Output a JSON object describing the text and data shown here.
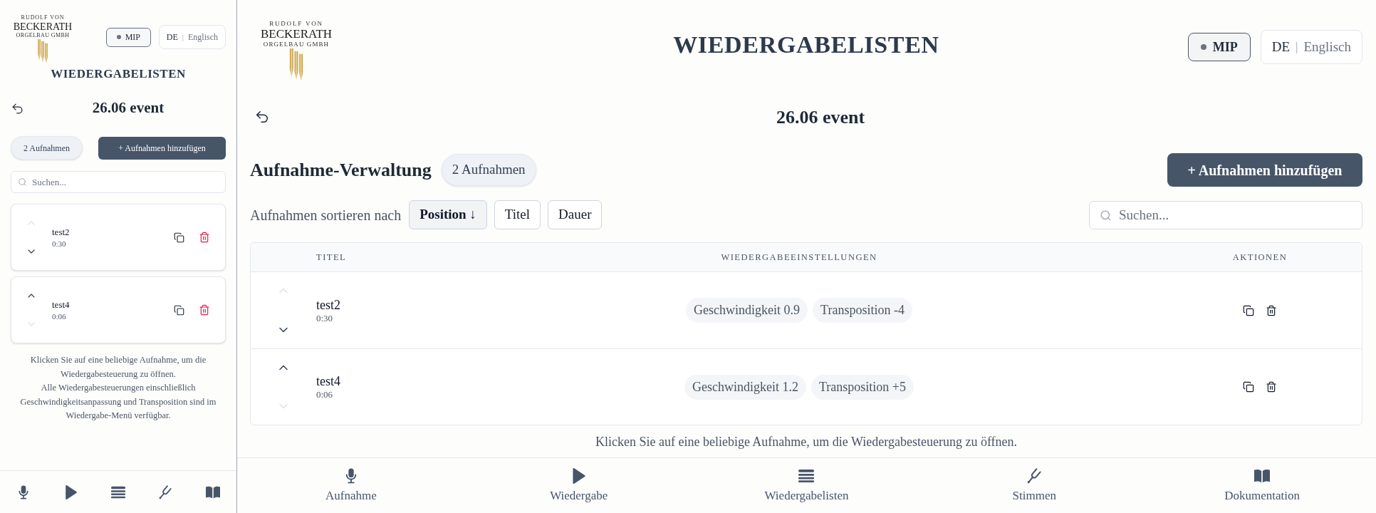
{
  "mobile_preview": {
    "logo": {
      "top_line": "RUDOLF VON",
      "name": "BECKERATH",
      "bottom_line": "ORGELBAU GMBH"
    },
    "mip_button": {
      "label": "MIP"
    },
    "language": {
      "options": [
        {
          "label": "DE",
          "selected": true
        },
        {
          "label": "Englisch",
          "selected": false
        }
      ],
      "separator": "|"
    },
    "page_title": "WIEDERGABELISTEN",
    "playlist_title": "26.06 event",
    "recording_count": "2 Aufnahmen",
    "add_button": "+ Aufnahmen hinzufügen",
    "search": {
      "placeholder": "Suchen..."
    },
    "recordings": [
      {
        "title": "test2",
        "duration": "0:30",
        "up_disabled": true,
        "down_disabled": false
      },
      {
        "title": "test4",
        "duration": "0:06",
        "up_disabled": false,
        "down_disabled": true
      }
    ],
    "help_text": [
      "Klicken Sie auf eine beliebige Aufnahme, um die Wiedergabesteuerung zu öffnen.",
      "Alle Wiedergabesteuerungen einschließlich Geschwindigkeitsanpassung und Transposition sind im Wiedergabe-Menü verfügbar."
    ]
  },
  "desktop": {
    "logo": {
      "top_line": "RUDOLF VON",
      "name": "BECKERATH",
      "bottom_line": "ORGELBAU GMBH"
    },
    "page_title": "WIEDERGABELISTEN",
    "mip_button": {
      "label": "MIP"
    },
    "language": {
      "options": [
        {
          "label": "DE",
          "selected": true
        },
        {
          "label": "Englisch",
          "selected": false
        }
      ],
      "separator": "|"
    },
    "playlist_title": "26.06 event",
    "section_title": "Aufnahme-Verwaltung",
    "recording_count": "2 Aufnahmen",
    "add_button": "+ Aufnahmen hinzufügen",
    "sort": {
      "label": "Aufnahmen sortieren nach",
      "options": [
        {
          "label": "Position ↓",
          "selected": true
        },
        {
          "label": "Titel",
          "selected": false
        },
        {
          "label": "Dauer",
          "selected": false
        }
      ]
    },
    "search": {
      "placeholder": "Suchen..."
    },
    "table": {
      "columns": [
        "TITEL",
        "WIEDERGABEEINSTELLUNGEN",
        "AKTIONEN"
      ],
      "rows": [
        {
          "title": "test2",
          "duration": "0:30",
          "up_disabled": true,
          "down_disabled": false,
          "settings": [
            "Geschwindigkeit 0.9",
            "Transposition -4"
          ]
        },
        {
          "title": "test4",
          "duration": "0:06",
          "up_disabled": false,
          "down_disabled": true,
          "settings": [
            "Geschwindigkeit 1.2",
            "Transposition +5"
          ]
        }
      ]
    },
    "help_text": "Klicken Sie auf eine beliebige Aufnahme, um die Wiedergabesteuerung zu öffnen.",
    "nav": [
      {
        "label": "Aufnahme"
      },
      {
        "label": "Wiedergabe"
      },
      {
        "label": "Wiedergabelisten"
      },
      {
        "label": "Stimmen"
      },
      {
        "label": "Dokumentation"
      }
    ]
  }
}
